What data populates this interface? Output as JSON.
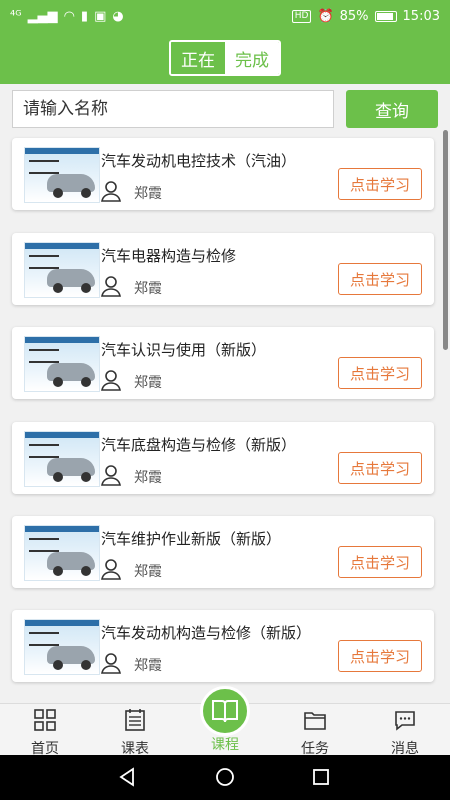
{
  "status_bar": {
    "left_signal": "⁴ᴳ",
    "battery_percent": "85%",
    "time": "15:03",
    "hd_badge": "HD"
  },
  "header": {
    "tabs": [
      {
        "label": "正在",
        "active": true
      },
      {
        "label": "完成",
        "active": false
      }
    ]
  },
  "search": {
    "placeholder": "请输入名称",
    "button_label": "查询"
  },
  "courses": [
    {
      "title": "汽车发动机电控技术（汽油）",
      "teacher": "郑霞",
      "action": "点击学习"
    },
    {
      "title": "汽车电器构造与检修",
      "teacher": "郑霞",
      "action": "点击学习"
    },
    {
      "title": "汽车认识与使用（新版）",
      "teacher": "郑霞",
      "action": "点击学习"
    },
    {
      "title": "汽车底盘构造与检修（新版）",
      "teacher": "郑霞",
      "action": "点击学习"
    },
    {
      "title": "汽车维护作业新版（新版）",
      "teacher": "郑霞",
      "action": "点击学习"
    },
    {
      "title": "汽车发动机构造与检修（新版）",
      "teacher": "郑霞",
      "action": "点击学习"
    }
  ],
  "bottom_nav": [
    {
      "label": "首页",
      "icon": "grid-icon"
    },
    {
      "label": "课表",
      "icon": "schedule-icon"
    },
    {
      "label": "课程",
      "icon": "book-icon",
      "active": true
    },
    {
      "label": "任务",
      "icon": "folder-icon"
    },
    {
      "label": "消息",
      "icon": "chat-icon"
    }
  ],
  "colors": {
    "accent": "#6cc04a",
    "action": "#e6783b"
  }
}
